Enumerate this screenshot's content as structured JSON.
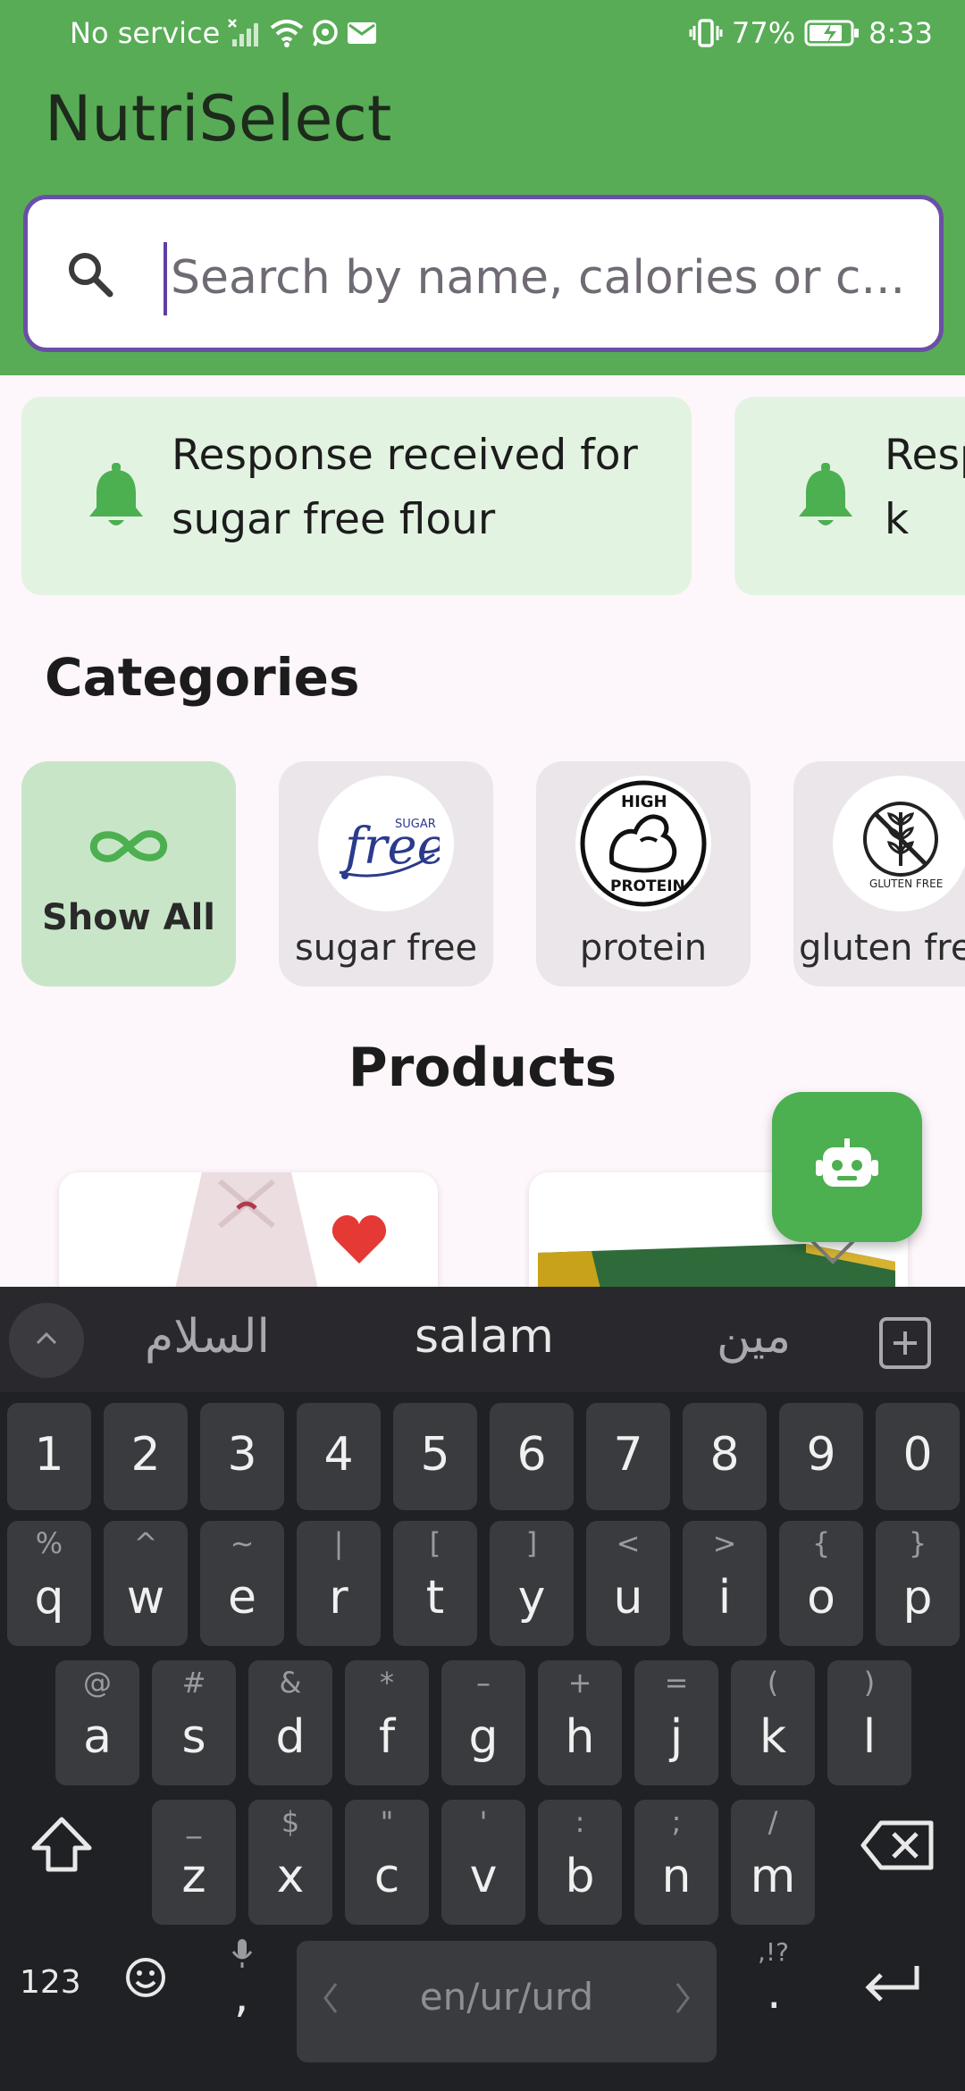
{
  "status_bar": {
    "carrier": "No service",
    "battery": "77%",
    "time": "8:33"
  },
  "app": {
    "title": "NutriSelect",
    "search_placeholder": "Search by name, calories or c..."
  },
  "notifications": [
    {
      "text": "Response received for sugar free flour"
    },
    {
      "text": "Response received for k"
    }
  ],
  "categories": {
    "title": "Categories",
    "items": [
      {
        "label": "Show All",
        "selected": true
      },
      {
        "label": "sugar free",
        "selected": false
      },
      {
        "label": "protein",
        "selected": false
      },
      {
        "label": "gluten free",
        "selected": false
      }
    ]
  },
  "products": {
    "title": "Products",
    "items": [
      {
        "favorite": true
      },
      {
        "favorite": false
      }
    ]
  },
  "keyboard": {
    "suggestions": [
      "السلام",
      "salam",
      "مین"
    ],
    "number_row": [
      "1",
      "2",
      "3",
      "4",
      "5",
      "6",
      "7",
      "8",
      "9",
      "0"
    ],
    "row1": [
      {
        "k": "q",
        "s": "%"
      },
      {
        "k": "w",
        "s": "^"
      },
      {
        "k": "e",
        "s": "~"
      },
      {
        "k": "r",
        "s": "|"
      },
      {
        "k": "t",
        "s": "["
      },
      {
        "k": "y",
        "s": "]"
      },
      {
        "k": "u",
        "s": "<"
      },
      {
        "k": "i",
        "s": ">"
      },
      {
        "k": "o",
        "s": "{"
      },
      {
        "k": "p",
        "s": "}"
      }
    ],
    "row2": [
      {
        "k": "a",
        "s": "@"
      },
      {
        "k": "s",
        "s": "#"
      },
      {
        "k": "d",
        "s": "&"
      },
      {
        "k": "f",
        "s": "*"
      },
      {
        "k": "g",
        "s": "–"
      },
      {
        "k": "h",
        "s": "+"
      },
      {
        "k": "j",
        "s": "="
      },
      {
        "k": "k",
        "s": "("
      },
      {
        "k": "l",
        "s": ")"
      }
    ],
    "row3": [
      {
        "k": "z",
        "s": "_"
      },
      {
        "k": "x",
        "s": "$"
      },
      {
        "k": "c",
        "s": "\""
      },
      {
        "k": "v",
        "s": "'"
      },
      {
        "k": "b",
        "s": ":"
      },
      {
        "k": "n",
        "s": ";"
      },
      {
        "k": "m",
        "s": "/"
      }
    ],
    "mode_label": "123",
    "comma": ",",
    "period": ".",
    "period_hint": ",!?",
    "space_label": "en/ur/urd"
  },
  "colors": {
    "header": "#58ac56",
    "accent_border": "#6a4fa6",
    "bell": "#4caf50",
    "fab": "#4caf50",
    "heart": "#e53935"
  }
}
